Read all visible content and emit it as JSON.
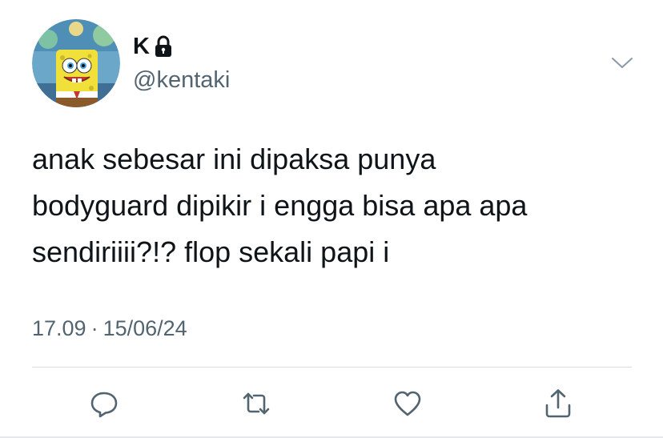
{
  "user": {
    "display_name": "K",
    "handle": "@kentaki",
    "protected_icon": "lock-icon",
    "avatar_icon": "spongebob-avatar"
  },
  "tweet": {
    "text": "anak sebesar ini dipaksa punya\nbodyguard dipikir i engga bisa apa apa\nsendiriiii?!? flop sekali papi i",
    "time": "17.09",
    "separator": "·",
    "date": "15/06/24"
  },
  "actions": [
    {
      "name": "reply",
      "icon": "reply-icon"
    },
    {
      "name": "retweet",
      "icon": "retweet-icon"
    },
    {
      "name": "like",
      "icon": "heart-icon"
    },
    {
      "name": "share",
      "icon": "share-icon"
    }
  ],
  "colors": {
    "text_primary": "#0f1419",
    "text_secondary": "#536471",
    "divider": "#d9dde1",
    "icon": "#536471"
  }
}
